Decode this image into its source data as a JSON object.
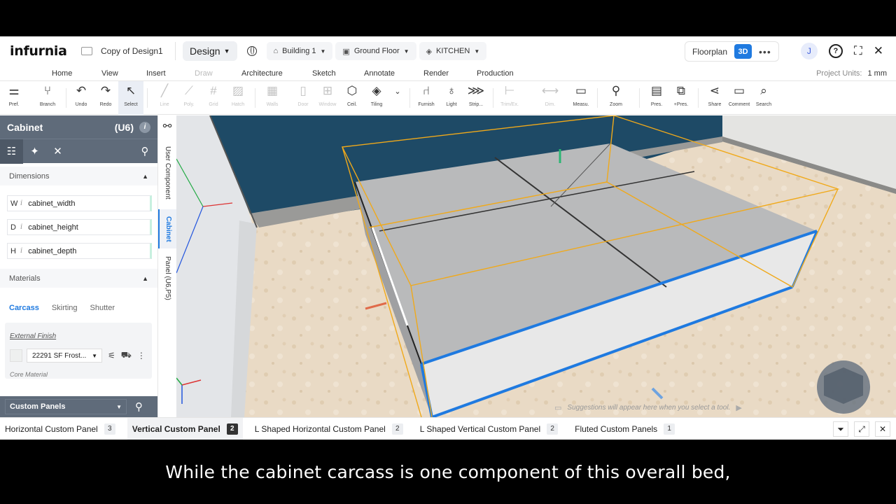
{
  "app": {
    "logo_text": "infurnia",
    "document_title": "Copy of Design1",
    "mode_label": "Design",
    "building": "Building 1",
    "floor": "Ground Floor",
    "room": "KITCHEN",
    "view_floorplan": "Floorplan",
    "view_3d": "3D",
    "more_label": "•••",
    "user_initial": "J",
    "help_label": "?",
    "accent_color": "#1f7ae0"
  },
  "menu_tabs": [
    {
      "label": "Home",
      "state": "active"
    },
    {
      "label": "View",
      "state": "normal"
    },
    {
      "label": "Insert",
      "state": "normal"
    },
    {
      "label": "Draw",
      "state": "disabled"
    },
    {
      "label": "Architecture",
      "state": "normal"
    },
    {
      "label": "Sketch",
      "state": "normal"
    },
    {
      "label": "Annotate",
      "state": "normal"
    },
    {
      "label": "Render",
      "state": "normal"
    },
    {
      "label": "Production",
      "state": "normal"
    }
  ],
  "project_units": {
    "label": "Project Units:",
    "value": "1 mm"
  },
  "toolbar": [
    {
      "label": "Pref.",
      "icon": "sliders-icon",
      "disabled": false
    },
    {
      "label": "Branch",
      "icon": "branch-icon",
      "disabled": false
    },
    {
      "label": "Undo",
      "icon": "undo-icon",
      "disabled": false
    },
    {
      "label": "Redo",
      "icon": "redo-icon",
      "disabled": false
    },
    {
      "label": "Select",
      "icon": "cursor-icon",
      "disabled": false,
      "selected": true
    },
    {
      "label": "Line",
      "icon": "line-icon",
      "disabled": true
    },
    {
      "label": "Poly.",
      "icon": "polyline-icon",
      "disabled": true
    },
    {
      "label": "Grid",
      "icon": "grid-icon",
      "disabled": true
    },
    {
      "label": "Hatch",
      "icon": "hatch-icon",
      "disabled": true
    },
    {
      "label": "Walls",
      "icon": "walls-icon",
      "disabled": true
    },
    {
      "label": "Door",
      "icon": "door-icon",
      "disabled": true
    },
    {
      "label": "Window",
      "icon": "window-icon",
      "disabled": true
    },
    {
      "label": "Ceil.",
      "icon": "ceiling-icon",
      "disabled": false
    },
    {
      "label": "Tiling",
      "icon": "tiling-icon",
      "disabled": false
    },
    {
      "label": "Furnish",
      "icon": "chair-icon",
      "disabled": false
    },
    {
      "label": "Light",
      "icon": "bulb-icon",
      "disabled": false
    },
    {
      "label": "Strip...",
      "icon": "strip-icon",
      "disabled": false
    },
    {
      "label": "Trim/Ex.",
      "icon": "trim-icon",
      "disabled": true
    },
    {
      "label": "Dim.",
      "icon": "dimension-icon",
      "disabled": true
    },
    {
      "label": "Measu.",
      "icon": "ruler-icon",
      "disabled": false
    },
    {
      "label": "Zoom",
      "icon": "zoom-icon",
      "disabled": false
    },
    {
      "label": "Pres.",
      "icon": "presentation-icon",
      "disabled": false
    },
    {
      "label": "+Pres.",
      "icon": "add-presentation-icon",
      "disabled": false
    },
    {
      "label": "Share",
      "icon": "share-icon",
      "disabled": false
    },
    {
      "label": "Comment",
      "icon": "comment-icon",
      "disabled": false
    },
    {
      "label": "Search",
      "icon": "doc-search-icon",
      "disabled": false
    }
  ],
  "left_panel": {
    "title": "Cabinet",
    "code": "(U6)",
    "dimensions_label": "Dimensions",
    "dimensions": [
      {
        "key": "W",
        "value": "cabinet_width"
      },
      {
        "key": "D",
        "value": "cabinet_height"
      },
      {
        "key": "H",
        "value": "cabinet_depth"
      }
    ],
    "materials_label": "Materials",
    "material_tabs": [
      "Carcass",
      "Skirting",
      "Shutter"
    ],
    "external_finish_label": "External Finish",
    "external_finish_value": "22291 SF Frost...",
    "core_material_label": "Core Material",
    "panel_select": "Custom Panels"
  },
  "side_tabs": [
    "User Component",
    "Cabinet",
    "Panel (U6,P5)"
  ],
  "viewport": {
    "suggestion": "Suggestions will appear here when you select a tool.",
    "wall_color": "#1e4a66",
    "floor_color": "#eadcc9",
    "selection_color": "#f0a91a",
    "edge_highlight": "#1f7ae0"
  },
  "bottom_tabs": [
    {
      "label": "Horizontal Custom Panel",
      "count": "3",
      "active": false
    },
    {
      "label": "Vertical Custom Panel",
      "count": "2",
      "active": true
    },
    {
      "label": "L Shaped Horizontal Custom Panel",
      "count": "2",
      "active": false
    },
    {
      "label": "L Shaped Vertical Custom Panel",
      "count": "2",
      "active": false
    },
    {
      "label": "Fluted Custom Panels",
      "count": "1",
      "active": false
    }
  ],
  "caption": "While the cabinet carcass is one component of this overall bed,"
}
